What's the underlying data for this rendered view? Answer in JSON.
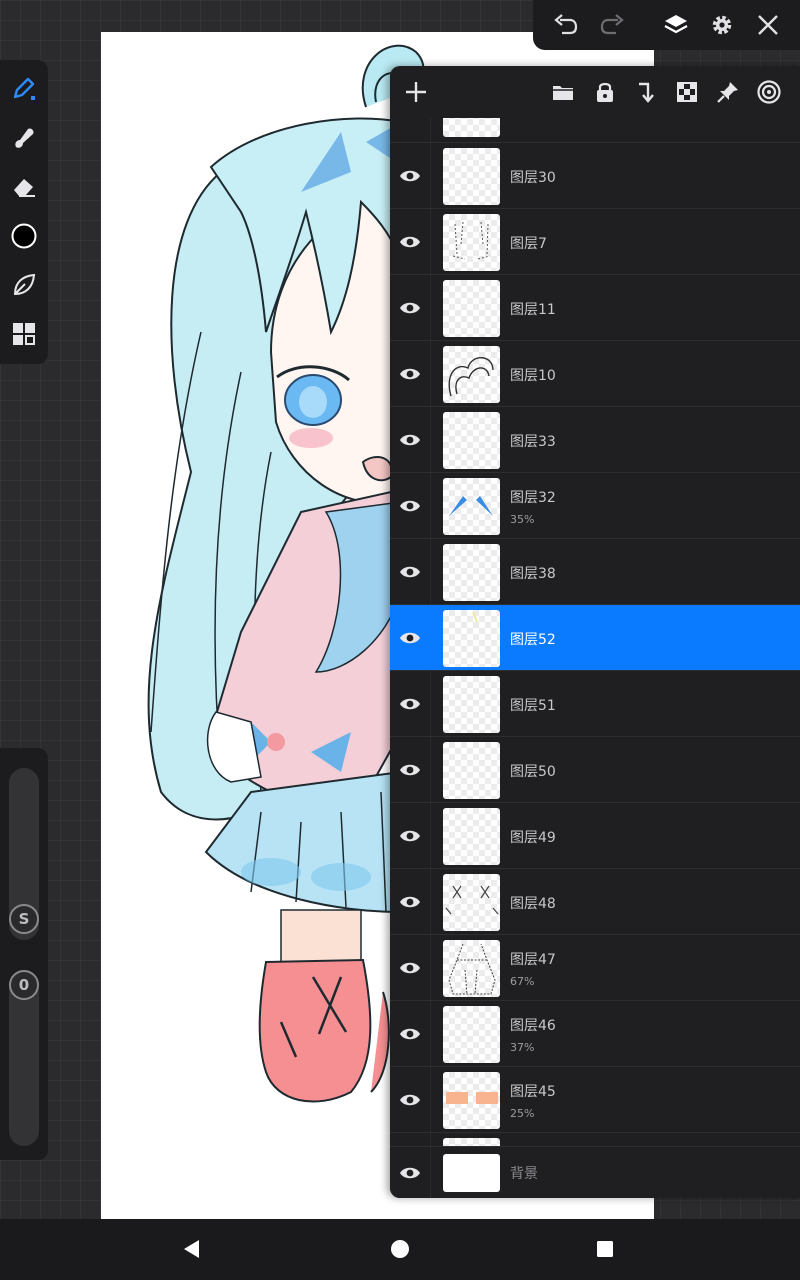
{
  "left_toolbar": {
    "tools": [
      {
        "icon": "pencil-icon",
        "active": true
      },
      {
        "icon": "smudge-icon"
      },
      {
        "icon": "eraser-icon"
      },
      {
        "icon": "color-circle-icon",
        "color": "#000000"
      },
      {
        "icon": "leaf-icon"
      },
      {
        "icon": "grid-icon"
      }
    ],
    "size_slider_label": "S",
    "opacity_slider_label": "0"
  },
  "top_toolbar": {
    "buttons": [
      "undo-icon",
      "redo-icon",
      "layers-icon",
      "gear-icon",
      "close-icon"
    ]
  },
  "layers_panel": {
    "toolbar": [
      "add-icon",
      "folder-icon",
      "lock-icon",
      "merge-down-icon",
      "checker-icon",
      "pin-icon",
      "spiral-icon"
    ],
    "layers": [
      {
        "name": "",
        "thumb": "partial",
        "cut": true
      },
      {
        "name": "图层30",
        "opacity": ""
      },
      {
        "name": "图层7",
        "opacity": "",
        "thumb": "shirt-lines"
      },
      {
        "name": "图层11",
        "opacity": ""
      },
      {
        "name": "图层10",
        "opacity": "",
        "thumb": "hair-curl"
      },
      {
        "name": "图层33",
        "opacity": ""
      },
      {
        "name": "图层32",
        "opacity": "35%",
        "thumb": "blue-wings"
      },
      {
        "name": "图层38",
        "opacity": ""
      },
      {
        "name": "图层52",
        "opacity": "",
        "selected": true
      },
      {
        "name": "图层51",
        "opacity": ""
      },
      {
        "name": "图层50",
        "opacity": ""
      },
      {
        "name": "图层49",
        "opacity": ""
      },
      {
        "name": "图层48",
        "opacity": "",
        "thumb": "x-marks"
      },
      {
        "name": "图层47",
        "opacity": "67%",
        "thumb": "dress-outline"
      },
      {
        "name": "图层46",
        "opacity": "37%"
      },
      {
        "name": "图层45",
        "opacity": "25%",
        "thumb": "orange-blocks"
      },
      {
        "name": "",
        "thumb": "partial",
        "cut": true
      }
    ],
    "background_layer": {
      "name": "背景"
    }
  },
  "colors": {
    "selected": "#0a7bff",
    "panel": "#1f1f21",
    "toolbar": "#1c1c1e"
  },
  "nav_bar": [
    "back-icon",
    "home-icon",
    "recents-icon"
  ]
}
